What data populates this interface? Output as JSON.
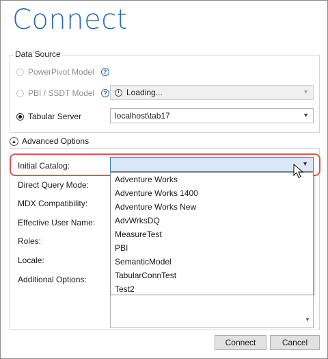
{
  "dialog": {
    "title": "Connect"
  },
  "data_source": {
    "group_label": "Data Source",
    "powerpivot_label": "PowerPivot Model",
    "pbi_label": "PBI / SSDT Model",
    "pbi_value": "Loading...",
    "tabular_label": "Tabular Server",
    "tabular_value": "localhost\\tab17",
    "selected": "Tabular Server"
  },
  "advanced": {
    "toggle_label": "Advanced Options",
    "labels": {
      "initial_catalog": "Initial Catalog:",
      "direct_query": "Direct Query Mode:",
      "mdx_compat": "MDX Compatibility:",
      "effective_user": "Effective User Name:",
      "roles": "Roles:",
      "locale": "Locale:",
      "additional": "Additional Options:"
    },
    "initial_catalog_value": "",
    "catalog_options": [
      "Adventure Works",
      "Adventure Works 1400",
      "Adventure Works New",
      "AdvWrksDQ",
      "MeasureTest",
      "PBI",
      "SemanticModel",
      "TabularConnTest",
      "Test2"
    ]
  },
  "buttons": {
    "connect": "Connect",
    "cancel": "Cancel"
  },
  "colors": {
    "title": "#2b6cb0",
    "highlight": "#e05454",
    "selected_input": "#dbe8f7"
  },
  "icons": {
    "help": "help-icon",
    "loading": "clock-icon",
    "chevron": "chevron-down-icon",
    "collapse": "chevron-up-icon",
    "cursor": "mouse-cursor-icon"
  }
}
